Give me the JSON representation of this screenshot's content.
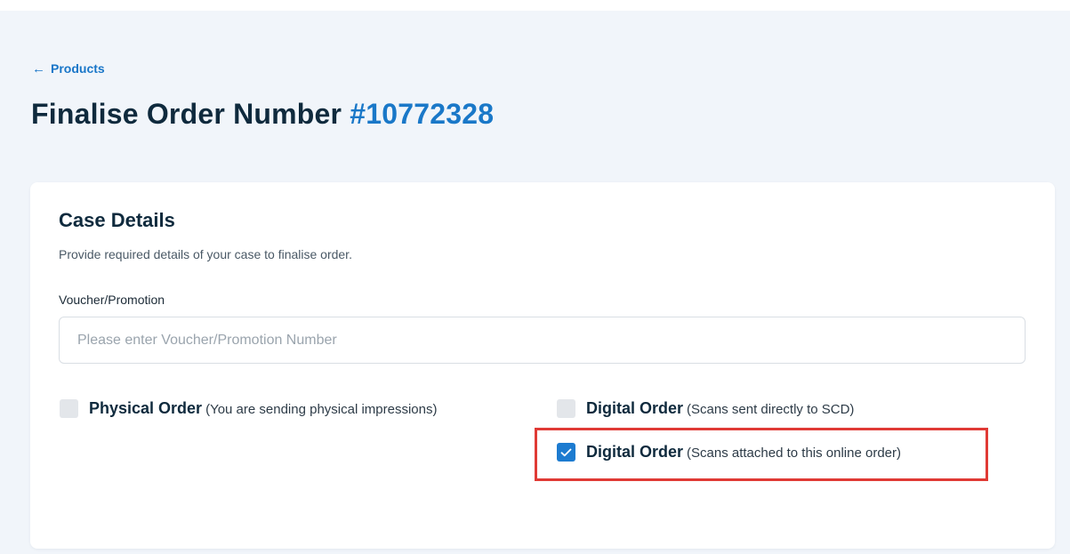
{
  "breadcrumb": {
    "back_arrow": "←",
    "back_label": "Products"
  },
  "header": {
    "title_prefix": "Finalise Order Number",
    "order_number": "#10772328"
  },
  "case_details": {
    "title": "Case Details",
    "subtitle": "Provide required details of your case to finalise order.",
    "voucher": {
      "label": "Voucher/Promotion",
      "placeholder": "Please enter Voucher/Promotion Number",
      "value": ""
    },
    "options": [
      {
        "label": "Physical Order",
        "note": "(You are sending physical impressions)",
        "checked": false
      },
      {
        "label": "Digital Order",
        "note": "(Scans sent directly to SCD)",
        "checked": false
      },
      {
        "label": "Digital Order",
        "note": "(Scans attached to this online order)",
        "checked": true
      }
    ]
  },
  "colors": {
    "accent": "#1a78c8",
    "checkbox_checked": "#1c7bd0",
    "checkbox_unchecked": "#e3e6ea",
    "highlight_border": "#e03a35",
    "page_background": "#f1f5fa",
    "heading_text": "#0f2a3d"
  },
  "icons": {
    "back": "arrow-left-icon",
    "check": "checkmark-icon"
  }
}
